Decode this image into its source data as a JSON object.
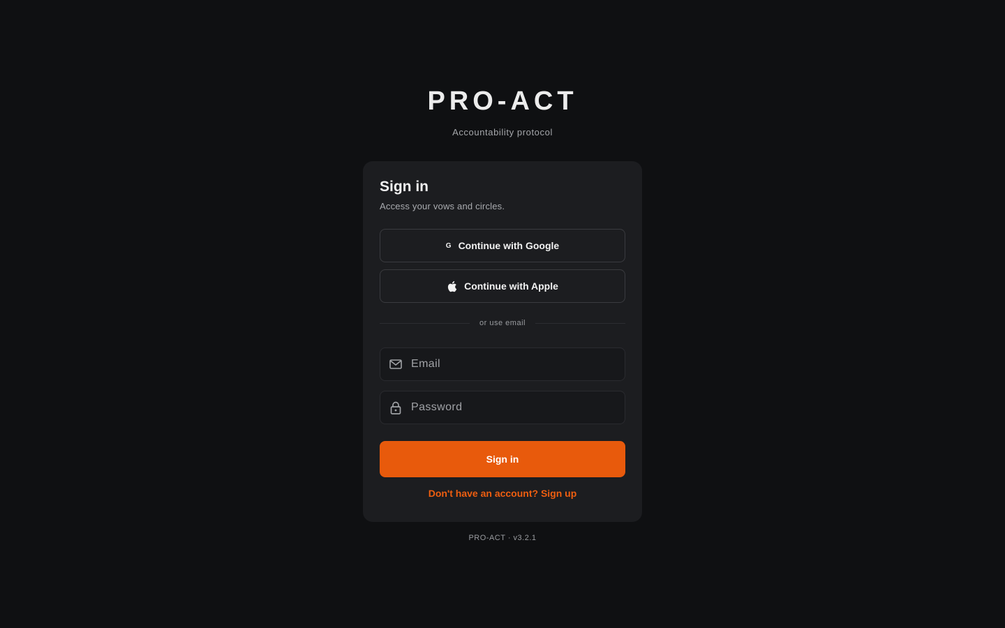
{
  "brand": {
    "title": "PRO-ACT",
    "subtitle": "Accountability protocol"
  },
  "card": {
    "title": "Sign in",
    "subtitle": "Access your vows and circles."
  },
  "oauth": {
    "google_label": "Continue with Google",
    "google_icon": "google-icon",
    "apple_label": "Continue with Apple",
    "apple_icon": "apple-icon"
  },
  "divider": {
    "label": "or use email"
  },
  "form": {
    "email_placeholder": "Email",
    "email_icon": "mail-icon",
    "password_placeholder": "Password",
    "password_icon": "lock-icon",
    "submit_label": "Sign in"
  },
  "signup_link": "Don't have an account? Sign up",
  "footer": "PRO-ACT · v3.2.1",
  "colors": {
    "background": "#0f1012",
    "card": "#1c1d20",
    "accent": "#e85a0c"
  }
}
